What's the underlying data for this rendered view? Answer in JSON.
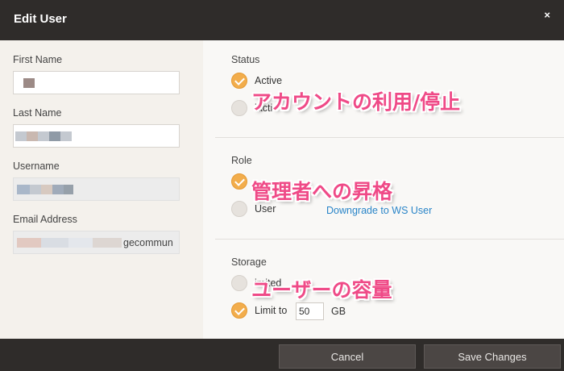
{
  "dialog": {
    "title": "Edit User",
    "close_glyph": "×"
  },
  "form": {
    "first_name_label": "First Name",
    "last_name_label": "Last Name",
    "username_label": "Username",
    "email_label": "Email Address",
    "email_visible_tail": "gecommun"
  },
  "status": {
    "label": "Status",
    "options": [
      {
        "label": "Active",
        "checked": true
      },
      {
        "label": "Inactive",
        "visible_label": "iacti",
        "checked": false
      }
    ]
  },
  "role": {
    "label": "Role",
    "options": [
      {
        "label": "Admin",
        "checked": true
      },
      {
        "label": "User",
        "checked": false
      }
    ],
    "downgrade_link": "Downgrade to WS User"
  },
  "storage": {
    "label": "Storage",
    "options": [
      {
        "label": "Unlimited",
        "visible_label": "imited",
        "checked": false
      },
      {
        "label": "Limit to",
        "checked": true
      }
    ],
    "limit_value": "50",
    "unit": "GB"
  },
  "annotations": {
    "status": "アカウントの利用/停止",
    "role": "管理者への昇格",
    "storage": "ユーザーの容量"
  },
  "footer": {
    "cancel": "Cancel",
    "save": "Save Changes"
  },
  "colors": {
    "titlebar": "#2f2c2a",
    "accent": "#f2ad4c",
    "link": "#2a85c8",
    "annotation": "#ef4a87"
  },
  "icons": {
    "close": "close-icon",
    "checked": "check-icon"
  }
}
